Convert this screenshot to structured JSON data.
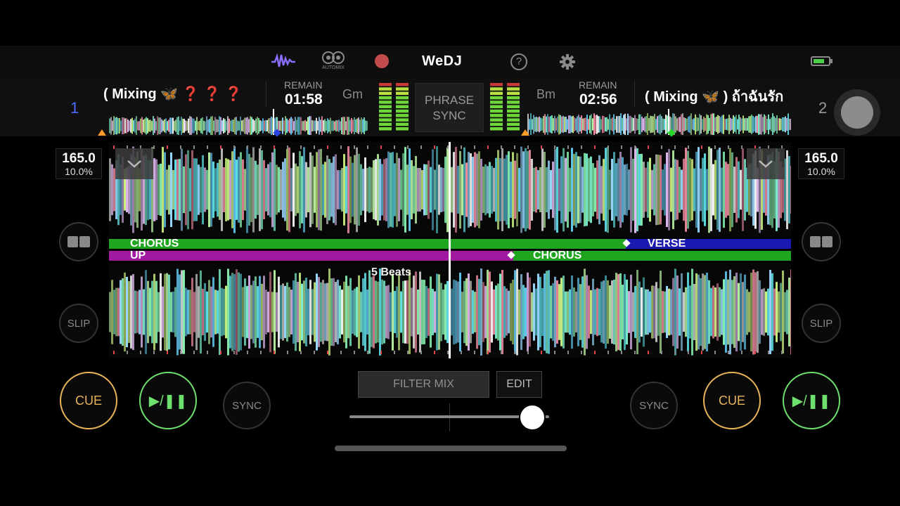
{
  "app": {
    "logo": "WeDJ",
    "automix_label": "AUTOMIX"
  },
  "deck1": {
    "number": "1",
    "title": "( Mixing 🦋  ❓ ❓ ❓",
    "remain_label": "REMAIN",
    "remain": "01:58",
    "key": "Gm",
    "bpm": "165.0",
    "pitch": "10.0%",
    "phrase_current": "CHORUS",
    "phrase_next": "VERSE"
  },
  "deck2": {
    "number": "2",
    "title": "( Mixing 🦋 ) ถ้าฉันรัก",
    "remain_label": "REMAIN",
    "remain": "02:56",
    "key": "Bm",
    "bpm": "165.0",
    "pitch": "10.0%",
    "phrase_current": "UP",
    "phrase_next": "CHORUS"
  },
  "center": {
    "phrase_sync_line1": "PHRASE",
    "phrase_sync_line2": "SYNC",
    "beats_overlay": "5 Beats",
    "filter_mix": "FILTER MIX",
    "edit": "EDIT",
    "crossfader_position": 0.83
  },
  "buttons": {
    "cue": "CUE",
    "play": "▶/❚❚",
    "sync": "SYNC",
    "slip": "SLIP"
  },
  "colors": {
    "deck1_accent": "#4f6dff",
    "cue": "#e8b45a",
    "play": "#6ee06e",
    "phrase_chorus": "#1fa51f",
    "phrase_up": "#a01aa0",
    "phrase_verse": "#1a1ab0",
    "record": "#c44b4b"
  },
  "battery_level": 0.75
}
